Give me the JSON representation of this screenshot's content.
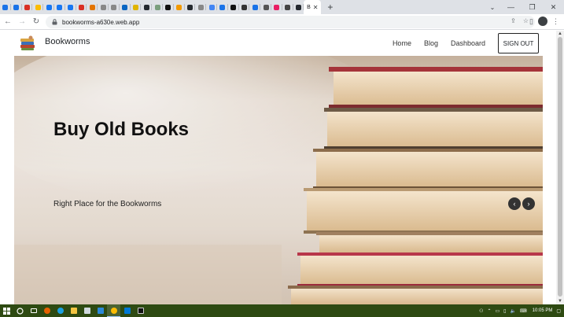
{
  "browser": {
    "tabs": [
      {
        "label": "P",
        "color": "#1a73e8"
      },
      {
        "label": "P",
        "color": "#1a73e8"
      },
      {
        "label": "M",
        "color": "#d93025"
      },
      {
        "label": "A",
        "color": "#fbbc04"
      },
      {
        "label": "F",
        "color": "#1877f2"
      },
      {
        "label": "F",
        "color": "#1877f2"
      },
      {
        "label": "F",
        "color": "#1877f2"
      },
      {
        "label": "N",
        "color": "#d93025"
      },
      {
        "label": "C",
        "color": "#e37400"
      },
      {
        "label": "C",
        "color": "#888888"
      },
      {
        "label": "C",
        "color": "#888888"
      },
      {
        "label": "F",
        "color": "#0a66c2"
      },
      {
        "label": "F",
        "color": "#e0b400"
      },
      {
        "label": "c",
        "color": "#24292f"
      },
      {
        "label": "S",
        "color": "#7a9e7e"
      },
      {
        "label": "L",
        "color": "#111111"
      },
      {
        "label": "T",
        "color": "#f29900"
      },
      {
        "label": "S",
        "color": "#24292f"
      },
      {
        "label": "G",
        "color": "#888888"
      },
      {
        "label": "G",
        "color": "#4285f4"
      },
      {
        "label": "P",
        "color": "#1a73e8"
      },
      {
        "label": "D",
        "color": "#111111"
      },
      {
        "label": "J",
        "color": "#333333"
      },
      {
        "label": "P",
        "color": "#1a73e8"
      },
      {
        "label": "P",
        "color": "#555555"
      },
      {
        "label": "P",
        "color": "#e91e63"
      },
      {
        "label": "I",
        "color": "#444444"
      },
      {
        "label": "C",
        "color": "#24292f"
      }
    ],
    "active_tab_label": "B",
    "url": "bookworms-a630e.web.app"
  },
  "navbar": {
    "brand": "Bookworms",
    "links": [
      "Home",
      "Blog",
      "Dashboard"
    ],
    "signout": "SIGN OUT"
  },
  "hero": {
    "title": "Buy Old Books",
    "subtitle": "Right Place for the Bookworms",
    "prev": "‹",
    "next": "›"
  },
  "taskbar": {
    "clock": "10:05 PM"
  }
}
